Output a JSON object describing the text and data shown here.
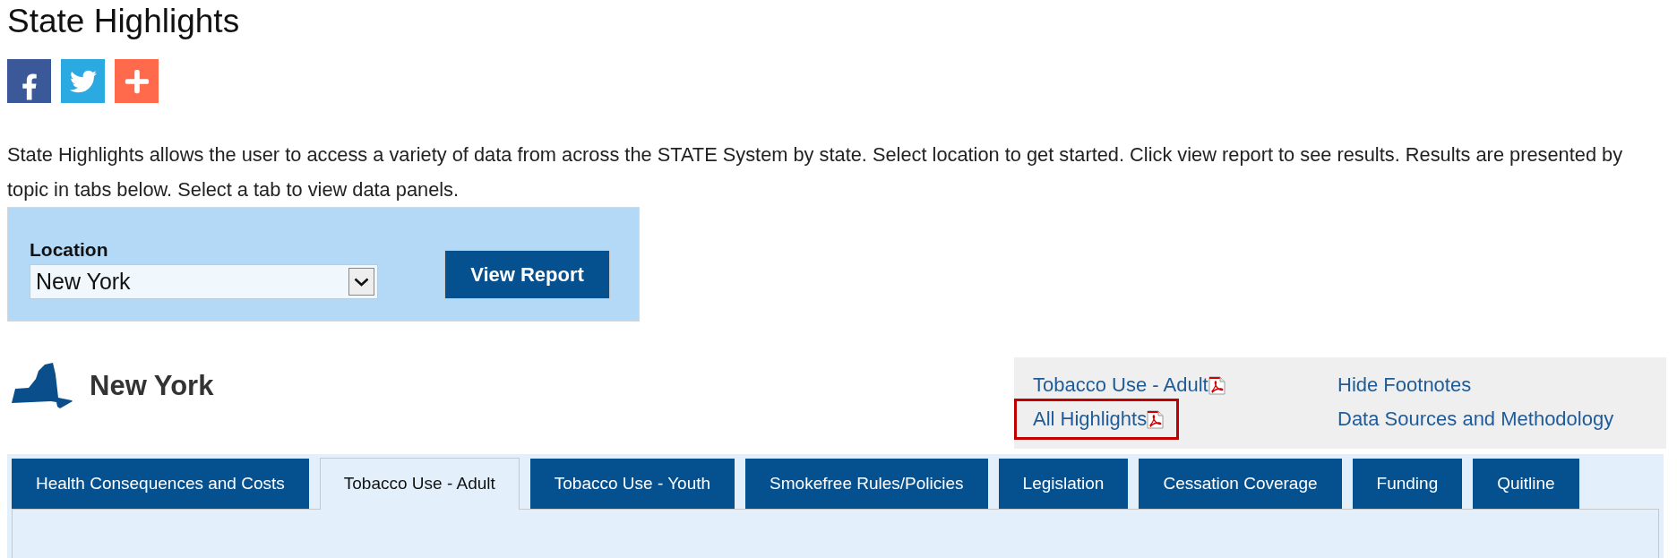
{
  "page": {
    "title": "State Highlights",
    "intro": "State Highlights allows the user to access a variety of data from across the STATE System by state. Select location to get started. Click view report to see results. Results are presented by topic in tabs below. Select a tab to view data panels."
  },
  "location_form": {
    "label": "Location",
    "value": "New York",
    "button": "View Report"
  },
  "state": {
    "name": "New York"
  },
  "report_links": [
    {
      "label": "Tobacco Use - Adult",
      "highlighted": false
    },
    {
      "label": "All Highlights",
      "highlighted": true
    }
  ],
  "page_links": [
    "Hide Footnotes",
    "Data Sources and Methodology"
  ],
  "tabs": [
    {
      "label": "Health Consequences and Costs",
      "selected": false
    },
    {
      "label": "Tobacco Use - Adult",
      "selected": true
    },
    {
      "label": "Tobacco Use - Youth",
      "selected": false
    },
    {
      "label": "Smokefree Rules/Policies",
      "selected": false
    },
    {
      "label": "Legislation",
      "selected": false
    },
    {
      "label": "Cessation Coverage",
      "selected": false
    },
    {
      "label": "Funding",
      "selected": false
    },
    {
      "label": "Quitline",
      "selected": false
    }
  ]
}
